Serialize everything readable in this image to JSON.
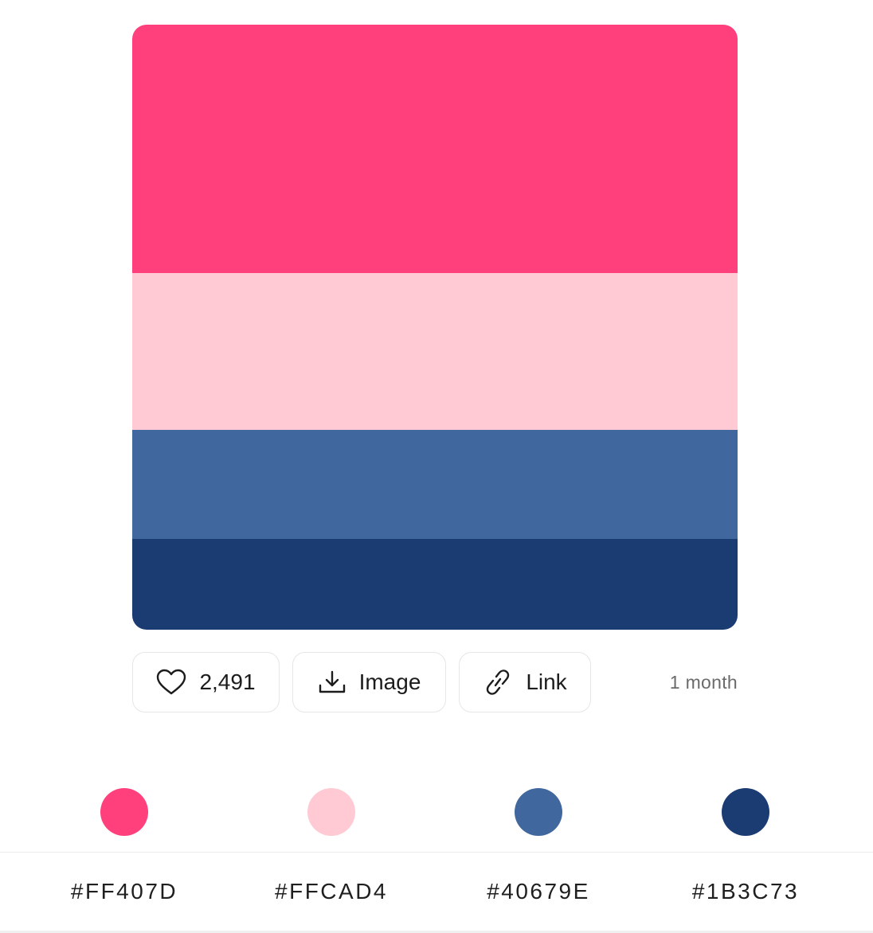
{
  "palette": {
    "colors": [
      "#FF407D",
      "#FFCAD4",
      "#40679E",
      "#1B3C73"
    ]
  },
  "actions": {
    "likes": "2,491",
    "image_label": "Image",
    "link_label": "Link",
    "age": "1 month"
  },
  "swatches": [
    {
      "hex": "#FF407D",
      "color": "#FF407D"
    },
    {
      "hex": "#FFCAD4",
      "color": "#FFCAD4"
    },
    {
      "hex": "#40679E",
      "color": "#40679E"
    },
    {
      "hex": "#1B3C73",
      "color": "#1B3C73"
    }
  ],
  "icons": {
    "like": "heart-icon",
    "image": "download-icon",
    "link": "link-icon"
  }
}
